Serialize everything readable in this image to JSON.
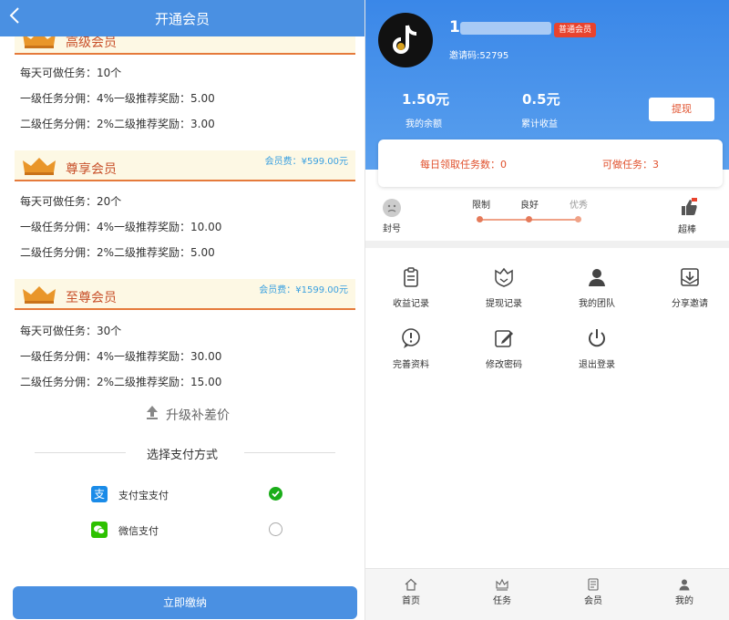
{
  "left": {
    "header_title": "开通会员",
    "back_icon": "chevron-left-icon",
    "tiers": [
      {
        "name": "高级会员",
        "fee": "",
        "lines": [
          "每天可做任务：10个",
          "一级任务分佣：4%一级推荐奖励：5.00",
          "二级任务分佣：2%二级推荐奖励：3.00"
        ]
      },
      {
        "name": "尊享会员",
        "fee": "会员费：¥599.00元",
        "lines": [
          "每天可做任务：20个",
          "一级任务分佣：4%一级推荐奖励：10.00",
          "二级任务分佣：2%二级推荐奖励：5.00"
        ]
      },
      {
        "name": "至尊会员",
        "fee": "会员费：¥1599.00元",
        "lines": [
          "每天可做任务：30个",
          "一级任务分佣：4%一级推荐奖励：30.00",
          "二级任务分佣：2%二级推荐奖励：15.00"
        ]
      }
    ],
    "upgrade_label": "升级补差价",
    "pay_title": "选择支付方式",
    "pay_methods": [
      {
        "label": "支付宝支付",
        "icon": "alipay-icon",
        "selected": true
      },
      {
        "label": "微信支付",
        "icon": "wechat-icon",
        "selected": false
      }
    ],
    "submit_label": "立即缴纳",
    "colors": {
      "primary": "#4a90e2",
      "accent": "#e57a3b",
      "fee": "#3aa0e0",
      "check": "#1aad19"
    }
  },
  "right": {
    "username": "1",
    "badge": "普通会员",
    "invite_code": "邀请码:52795",
    "balance_value": "1.50元",
    "balance_label": "我的余额",
    "earnings_value": "0.5元",
    "earnings_label": "累计收益",
    "withdraw_label": "提现",
    "daily_tasks": "每日领取任务数：0",
    "available_tasks": "可做任务：3",
    "level_left": "封号",
    "level_labels": [
      "限制",
      "良好",
      "优秀"
    ],
    "level_right": "超棒",
    "menu": [
      {
        "label": "收益记录",
        "icon": "clipboard-icon"
      },
      {
        "label": "提现记录",
        "icon": "shield-icon"
      },
      {
        "label": "我的团队",
        "icon": "team-icon"
      },
      {
        "label": "分享邀请",
        "icon": "share-icon"
      },
      {
        "label": "完善资料",
        "icon": "info-icon"
      },
      {
        "label": "修改密码",
        "icon": "edit-icon"
      },
      {
        "label": "退出登录",
        "icon": "power-icon"
      }
    ],
    "tabs": [
      {
        "label": "首页",
        "icon": "home-icon"
      },
      {
        "label": "任务",
        "icon": "crown-icon"
      },
      {
        "label": "会员",
        "icon": "member-card-icon"
      },
      {
        "label": "我的",
        "icon": "user-icon"
      }
    ],
    "colors": {
      "header_top": "#3a87e8",
      "header_bottom": "#5aa0ee",
      "badge": "#e8432e",
      "accent": "#e0502c"
    }
  }
}
